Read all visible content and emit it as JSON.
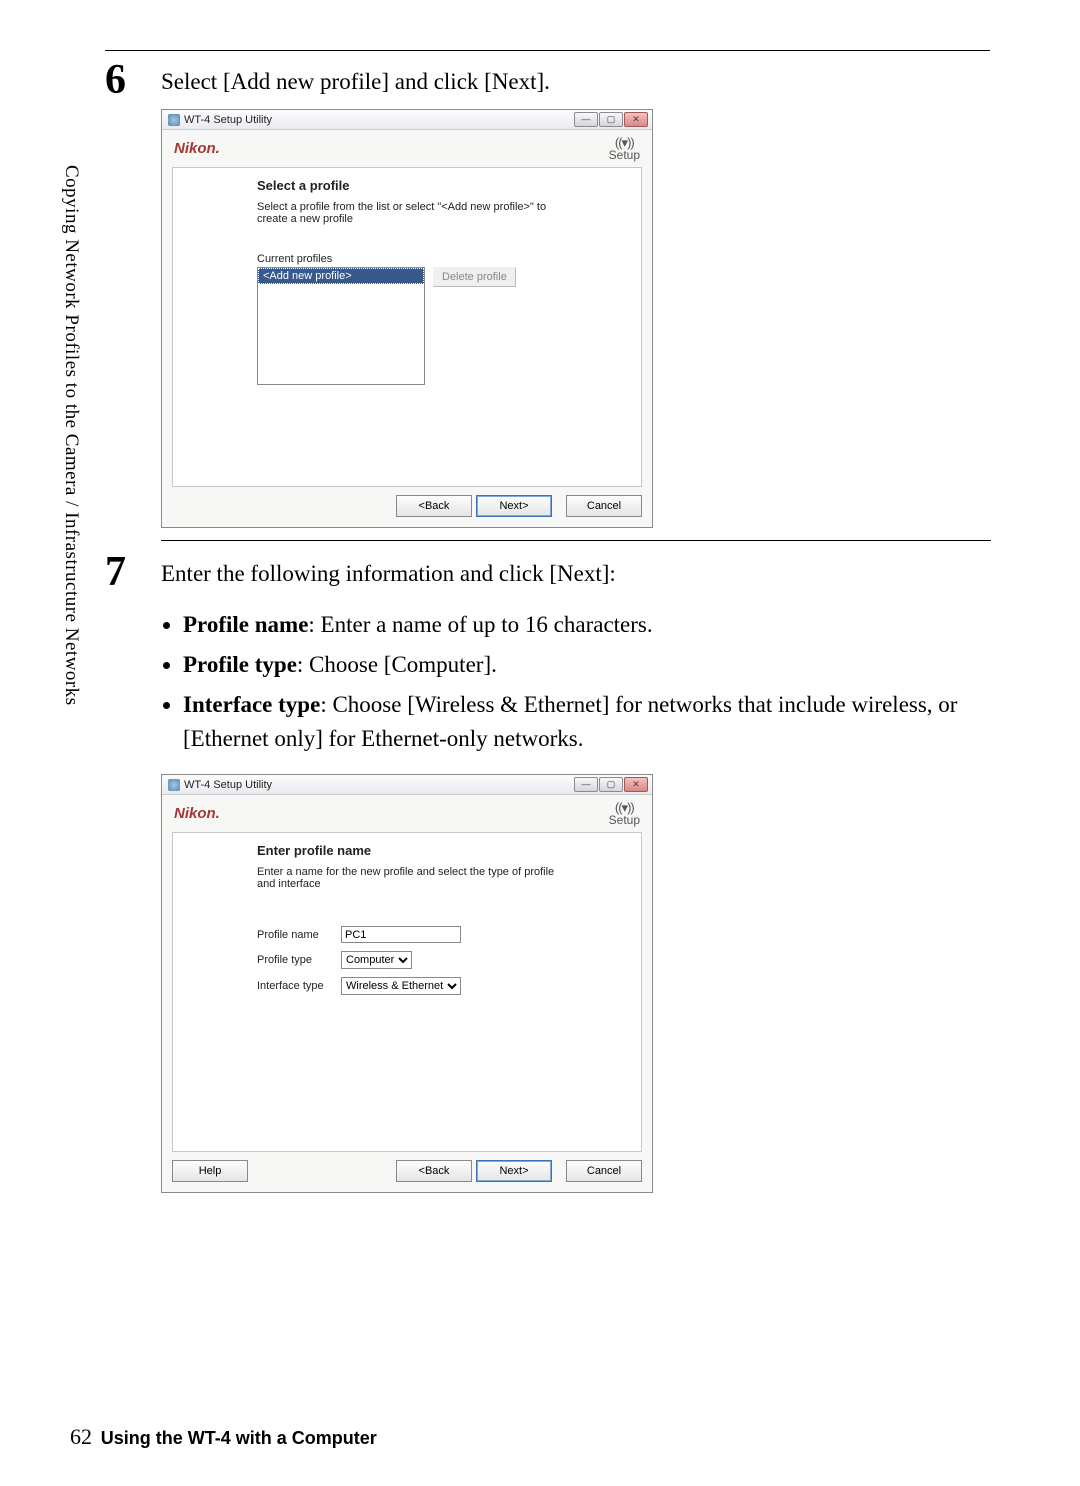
{
  "sidebarText": "Copying Network Profiles to the Camera / Infrastructure Networks",
  "step6": {
    "num": "6",
    "text": "Select [Add new profile] and click [Next]."
  },
  "step7": {
    "num": "7",
    "text": "Enter the following information and click [Next]:",
    "bullets": [
      {
        "label": "Profile name",
        "rest": ": Enter a name of up to 16 characters."
      },
      {
        "label": "Profile type",
        "rest": ": Choose [Computer]."
      },
      {
        "label": "Interface type",
        "rest": ": Choose [Wireless & Ethernet] for networks that include wireless, or [Ethernet only] for Ethernet-only networks."
      }
    ]
  },
  "dialog": {
    "title": "WT-4 Setup Utility",
    "brand": "Nikon.",
    "setupLabel": "Setup",
    "winMin": "—",
    "winMax": "▢",
    "winClose": "✕"
  },
  "dialog1": {
    "panelTitle": "Select a profile",
    "panelDesc": "Select a profile from the list or select \"<Add new profile>\" to create a new profile",
    "currentProfilesLabel": "Current profiles",
    "listItem": "<Add new profile>",
    "deleteBtn": "Delete profile",
    "back": "<Back",
    "next": "Next>",
    "cancel": "Cancel"
  },
  "dialog2": {
    "panelTitle": "Enter profile name",
    "panelDesc": "Enter a name for the new profile and select the type of profile and interface",
    "profileNameLabel": "Profile name",
    "profileNameValue": "PC1",
    "profileTypeLabel": "Profile type",
    "profileTypeValue": "Computer",
    "interfaceTypeLabel": "Interface type",
    "interfaceTypeValue": "Wireless & Ethernet",
    "help": "Help",
    "back": "<Back",
    "next": "Next>",
    "cancel": "Cancel"
  },
  "footer": {
    "page": "62",
    "title": "Using the WT-4 with a Computer"
  }
}
